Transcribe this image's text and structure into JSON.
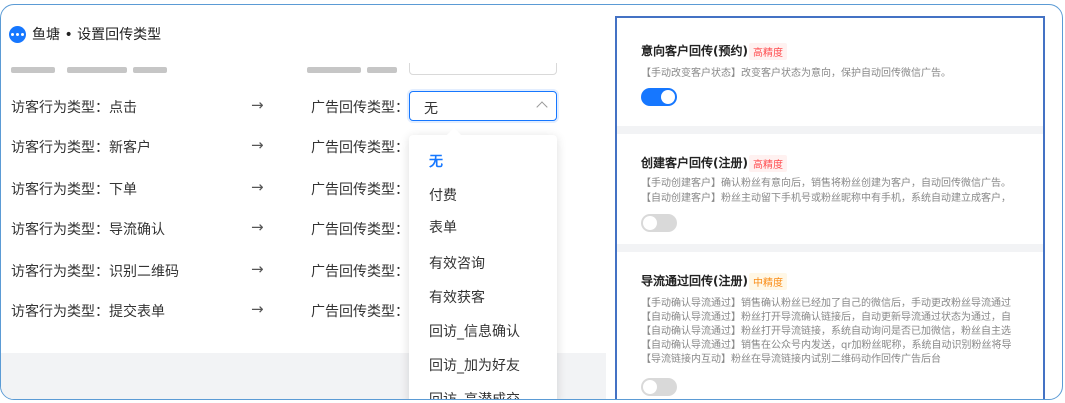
{
  "window": {
    "title": "鱼塘 • 设置回传类型"
  },
  "mapping": {
    "arrow": "→",
    "rows": [
      {
        "visitor_label": "访客行为类型：点击",
        "ad_label": "广告回传类型："
      },
      {
        "visitor_label": "访客行为类型：新客户",
        "ad_label": "广告回传类型："
      },
      {
        "visitor_label": "访客行为类型：下单",
        "ad_label": "广告回传类型："
      },
      {
        "visitor_label": "访客行为类型：导流确认",
        "ad_label": "广告回传类型："
      },
      {
        "visitor_label": "访客行为类型：识别二维码",
        "ad_label": "广告回传类型："
      },
      {
        "visitor_label": "访客行为类型：提交表单",
        "ad_label": "广告回传类型："
      }
    ],
    "select_value": "无"
  },
  "dropdown": {
    "options": [
      "无",
      "付费",
      "表单",
      "有效咨询",
      "有效获客",
      "回访_信息确认",
      "回访_加为好友",
      "回访_高潜成交"
    ],
    "selected": "无"
  },
  "right_panel": {
    "cards": [
      {
        "title": "意向客户回传(预约)",
        "badge": "高精度",
        "lines": [
          "【手动改变客户状态】改变客户状态为意向，保护自动回传微信广告。"
        ],
        "toggle_on": true
      },
      {
        "title": "创建客户回传(注册)",
        "badge": "高精度",
        "lines": [
          "【手动创建客户】确认粉丝有意向后，销售将粉丝创建为客户，自动回传微信广告。",
          "【自动创建客户】粉丝主动留下手机号或粉丝昵称中有手机，系统自动建立成客户，"
        ],
        "toggle_on": false
      },
      {
        "title": "导流通过回传(注册)",
        "badge": "中精度",
        "lines": [
          "【手动确认导流通过】销售确认粉丝已经加了自己的微信后，手动更改粉丝导流通过",
          "【自动确认导流通过】粉丝打开导流确认链接后，自动更新导流通过状态为通过，自",
          "【自动确认导流通过】粉丝打开导流链接，系统自动询问是否已加微信，粉丝自主选",
          "【自动确认导流通过】销售在公众号内发送，qr加粉丝昵称，系统自动识别粉丝将导",
          "【导流链接内互动】粉丝在导流链接内试别二维码动作回传广告后台"
        ],
        "toggle_on": false
      }
    ]
  },
  "colors": {
    "accent": "#1677ff",
    "panel_border": "#4472c4",
    "badge_red": "#ff4d4f",
    "badge_orange": "#fa8c16"
  },
  "icons": {
    "logo": "chat-bubble-icon",
    "select_chevron": "chevron-up-icon"
  }
}
